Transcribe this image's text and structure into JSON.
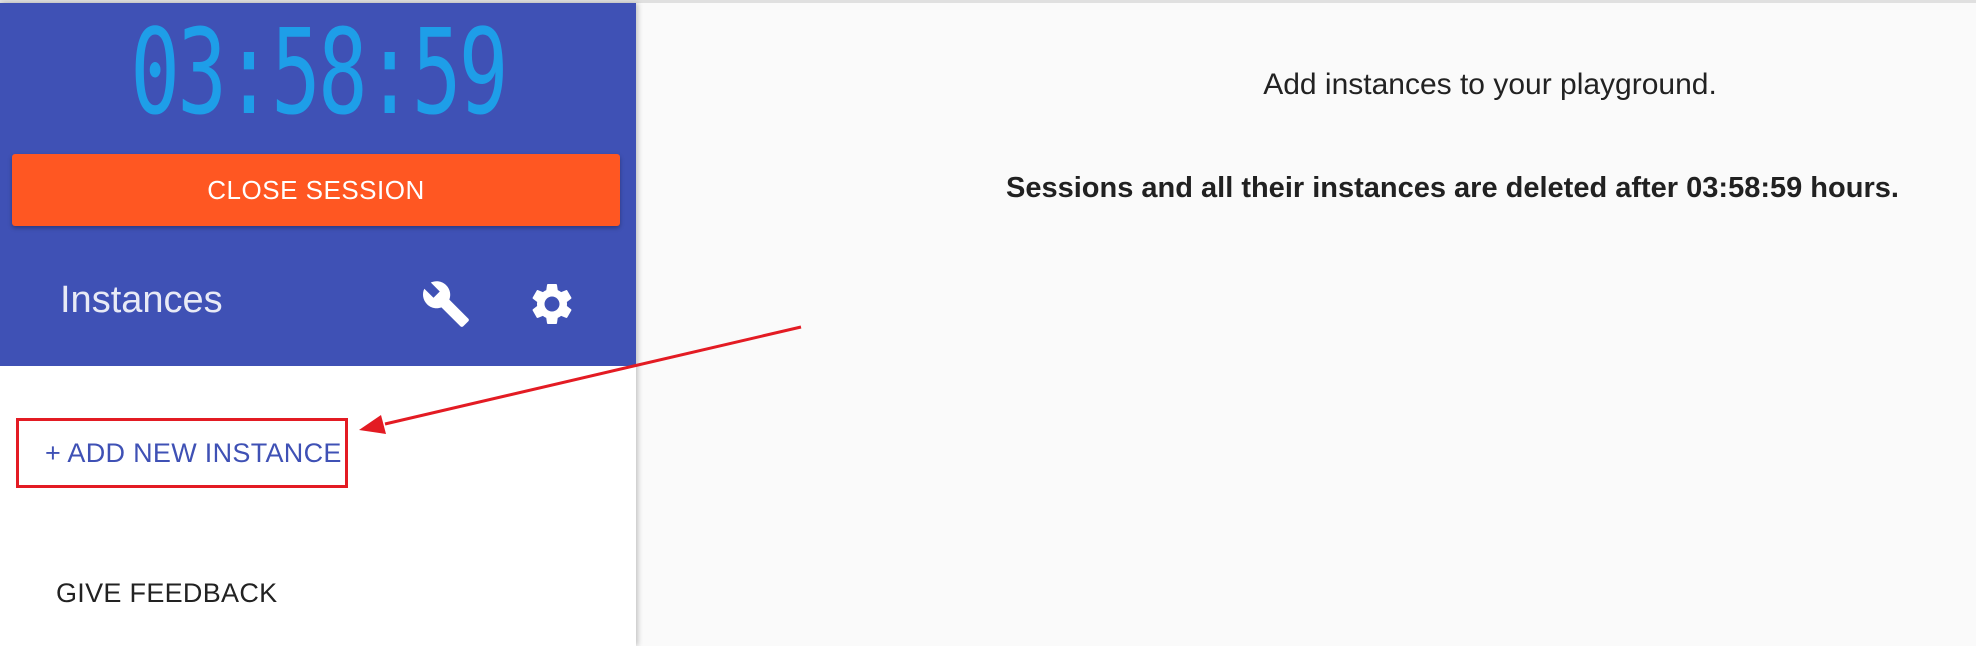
{
  "sidebar": {
    "timer": "03:58:59",
    "close_session_label": "CLOSE SESSION",
    "instances_title": "Instances",
    "add_instance_label": "+ ADD NEW INSTANCE",
    "give_feedback_label": "GIVE FEEDBACK",
    "icons": [
      "wrench-icon",
      "settings-gear-icon"
    ]
  },
  "main": {
    "hint": "Add instances to your playground.",
    "warning": "Sessions and all their instances are deleted after 03:58:59 hours."
  },
  "colors": {
    "header_bg": "#3f51b5",
    "timer_text": "#1e9ee8",
    "close_button_bg": "#ff5722",
    "link_text": "#3f51b5",
    "annotation": "#e31b23",
    "main_bg": "#fafafa"
  }
}
